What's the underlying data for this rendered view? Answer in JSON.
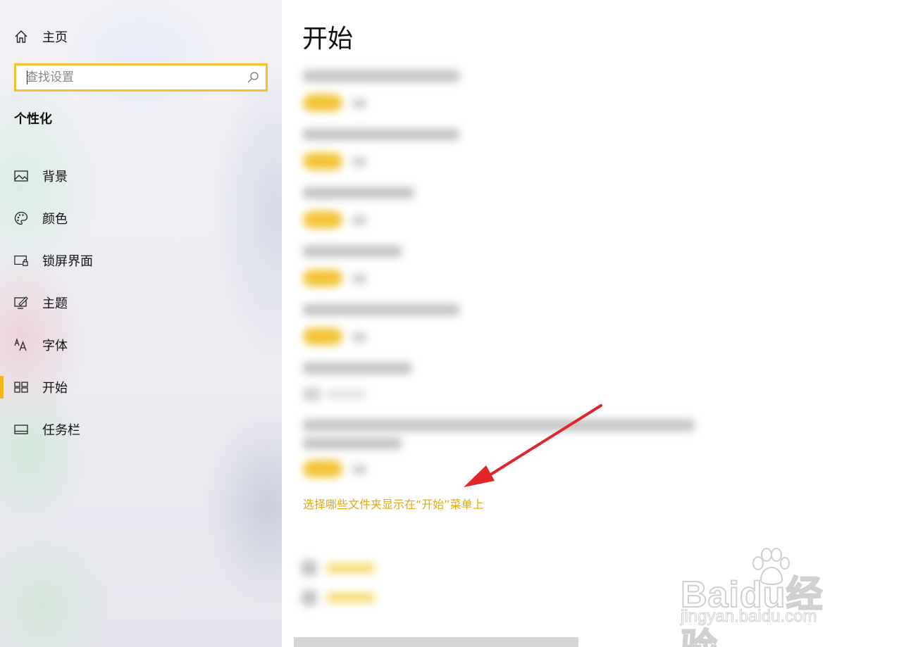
{
  "sidebar": {
    "home_label": "主页",
    "search": {
      "placeholder": "查找设置",
      "value": ""
    },
    "section_title": "个性化",
    "items": [
      {
        "label": "背景",
        "icon": "picture-icon"
      },
      {
        "label": "颜色",
        "icon": "palette-icon"
      },
      {
        "label": "锁屏界面",
        "icon": "lock-screen-icon"
      },
      {
        "label": "主题",
        "icon": "theme-icon"
      },
      {
        "label": "字体",
        "icon": "font-icon"
      },
      {
        "label": "开始",
        "icon": "start-icon",
        "active": true
      },
      {
        "label": "任务栏",
        "icon": "taskbar-icon"
      }
    ]
  },
  "main": {
    "title": "开始",
    "folders_link": "选择哪些文件夹显示在“开始”菜单上"
  },
  "watermark": {
    "brand": "Baidu经验",
    "url": "jingyan.baidu.com"
  },
  "colors": {
    "accent": "#f2c230",
    "link": "#e3a811",
    "arrow": "#e0262b"
  }
}
